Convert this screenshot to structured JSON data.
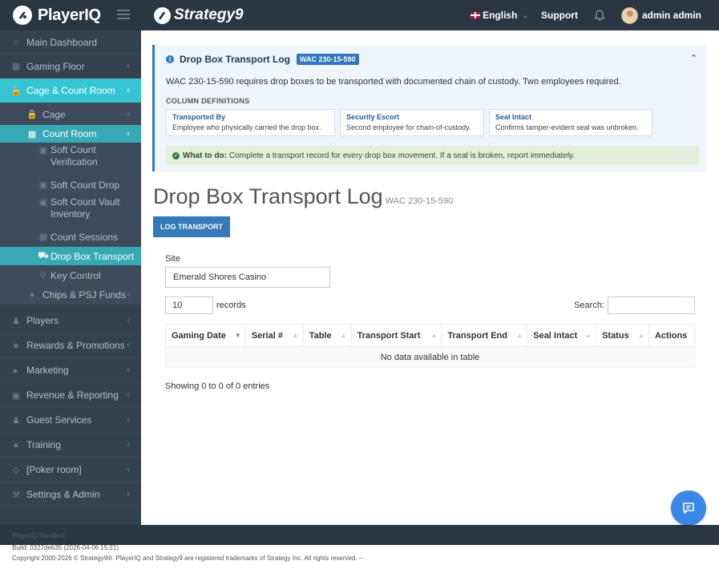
{
  "header": {
    "brand": "PlayerIQ",
    "partner": "Strategy9",
    "language": "English",
    "support": "Support",
    "user_name": "admin admin"
  },
  "sidebar": {
    "main_dashboard": "Main Dashboard",
    "gaming_floor": "Gaming Floor",
    "cage_count_room": "Cage & Count Room",
    "cage": "Cage",
    "count_room": "Count Room",
    "soft_count_verification": "Soft Count Verification",
    "soft_count_drop": "Soft Count Drop",
    "soft_count_vault_inventory": "Soft Count Vault Inventory",
    "count_sessions": "Count Sessions",
    "drop_box_transport": "Drop Box Transport",
    "key_control": "Key Control",
    "chips_psj_funds": "Chips & PSJ Funds",
    "players": "Players",
    "rewards_promotions": "Rewards & Promotions",
    "marketing": "Marketing",
    "revenue_reporting": "Revenue & Reporting",
    "guest_services": "Guest Services",
    "training": "Training",
    "poker_room": "[Poker room]",
    "settings_admin": "Settings & Admin"
  },
  "note": {
    "title": "Drop Box Transport Log",
    "badge": "WAC 230-15-590",
    "text": "WAC 230-15-590 requires drop boxes to be transported with documented chain of custody. Two employees required.",
    "column_definitions_label": "COLUMN DEFINITIONS",
    "definitions": [
      {
        "name": "Transported By",
        "desc": "Employee who physically carried the drop box."
      },
      {
        "name": "Security Escort",
        "desc": "Second employee for chain-of-custody."
      },
      {
        "name": "Seal Intact",
        "desc": "Confirms tamper-evident seal was unbroken."
      }
    ],
    "todo_label": "What to do:",
    "todo_text": "Complete a transport record for every drop box movement. If a seal is broken, report immediately."
  },
  "page": {
    "title": "Drop Box Transport Log",
    "subtitle": "WAC 230-15-590",
    "log_button": "LOG TRANSPORT",
    "site_label": "Site",
    "site_value": "Emerald Shores Casino",
    "length_value": "10",
    "length_suffix": "records",
    "search_label": "Search:",
    "search_placeholder": "",
    "columns": [
      "Gaming Date",
      "Serial #",
      "Table",
      "Transport Start",
      "Transport End",
      "Seal Intact",
      "Status",
      "Actions"
    ],
    "empty_message": "No data available in table",
    "info": "Showing 0 to 0 of 0 entries"
  },
  "footer": {
    "edition": "PlayerIQ Standard",
    "build": "Build: 0327deb35 (2026-04-06 15:21)",
    "copyright": "Copyright 2000-2026 © Strategy9®. PlayerIQ and Strategy9 are registered trademarks of Strategy Inc. All rights reserved. --"
  },
  "colors": {
    "topbar": "#2b3643",
    "sidebar": "#364150",
    "accent": "#36c6d3",
    "primary": "#337ab7",
    "chat": "#3a87e6"
  }
}
